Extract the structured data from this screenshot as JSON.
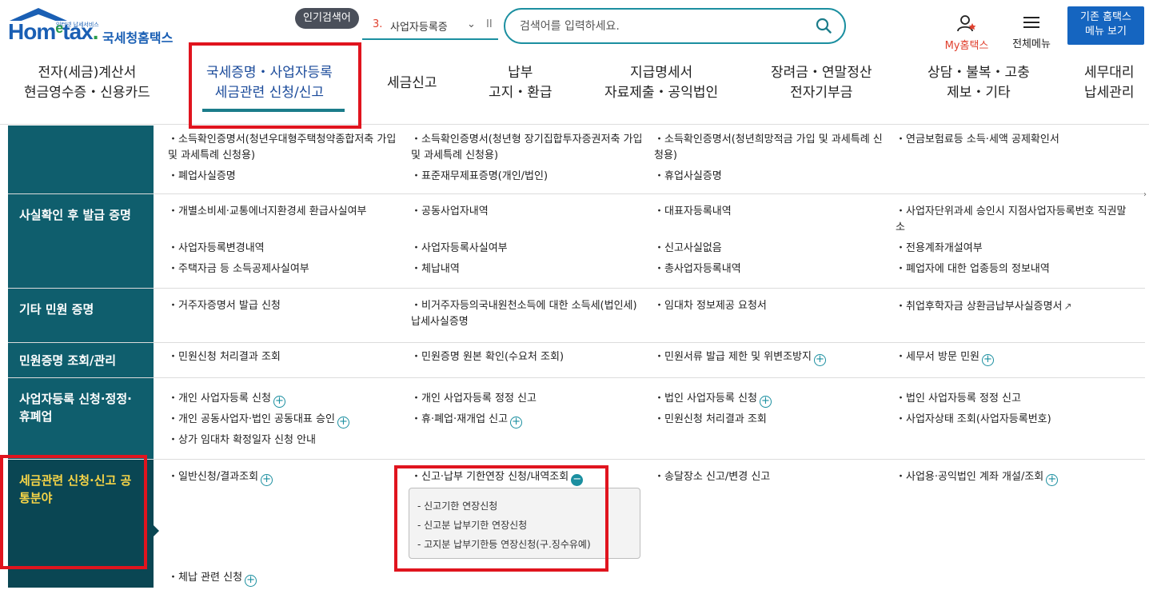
{
  "header": {
    "logo_text": "Hometax.",
    "logo_tagline": "인터넷 납세서비스",
    "logo_kname": "국세청홈택스",
    "popular_label": "인기검색어",
    "popular_rank": "3.",
    "popular_term": "사업자등록증",
    "popular_chevron": "⌄",
    "popular_pause": "II",
    "search_placeholder": "검색어를 입력하세요.",
    "myhome_label": "My홈택스",
    "allmenu_label": "전체메뉴",
    "oldhome_line1": "기존 홈택스",
    "oldhome_line2": "메뉴 보기"
  },
  "gnb": [
    {
      "line1": "전자(세금)계산서",
      "line2": "현금영수증・신용카드"
    },
    {
      "line1": "국세증명・사업자등록",
      "line2": "세금관련 신청/신고"
    },
    {
      "line1": "세금신고",
      "line2": ""
    },
    {
      "line1": "납부",
      "line2": "고지・환급"
    },
    {
      "line1": "지급명세서",
      "line2": "자료제출・공익법인"
    },
    {
      "line1": "장려금・연말정산",
      "line2": "전자기부금"
    },
    {
      "line1": "상담・불복・고충",
      "line2": "제보・기타"
    },
    {
      "line1": "세무대리",
      "line2": "납세관리"
    }
  ],
  "rows": [
    {
      "head": "",
      "cells": [
        "・소득확인증명서(청년우대형주택청약종합저축 가입 및 과세특례 신청용)",
        "・소득확인증명서(청년형 장기집합투자증권저축 가입 및 과세특례 신청용)",
        "・소득확인증명서(청년희망적금 가입 및 과세특례 신청용)",
        "・연금보험료등 소득·세액 공제확인서",
        "・폐업사실증명",
        "・표준재무제표증명(개인/법인)",
        "・휴업사실증명"
      ]
    },
    {
      "head": "사실확인 후 발급 증명",
      "cells": [
        "・개별소비세·교통에너지환경세 환급사실여부",
        "・공동사업자내역",
        "・대표자등록내역",
        "・사업자단위과세 승인시 지점사업자등록번호 직권말소",
        "・사업자등록변경내역",
        "・사업자등록사실여부",
        "・신고사실없음",
        "・전용계좌개설여부",
        "・주택자금 등 소득공제사실여부",
        "・체납내역",
        "・총사업자등록내역",
        "・폐업자에 대한 업종등의 정보내역"
      ]
    },
    {
      "head": "기타 민원 증명",
      "cells": [
        "・거주자증명서 발급 신청",
        "・비거주자등의국내원천소득에 대한 소득세(법인세) 납세사실증명",
        "・임대차 정보제공 요청서",
        "・취업후학자금 상환금납부사실증명서"
      ]
    },
    {
      "head": "민원증명 조회/관리",
      "cells": [
        "・민원신청 처리결과 조회",
        "・민원증명 원본 확인(수요처 조회)",
        "・민원서류 발급 제한 및 위변조방지",
        "・세무서 방문 민원"
      ]
    },
    {
      "head": "사업자등록 신청·정정·휴폐업",
      "cells": [
        "・개인 사업자등록 신청",
        "・개인 사업자등록 정정 신고",
        "・법인 사업자등록 신청",
        "・법인 사업자등록 정정 신고",
        "・개인 공동사업자·법인 공동대표 승인",
        "・휴·폐업·재개업 신고",
        "・민원신청 처리결과 조회",
        "・사업자상태 조회(사업자등록번호)",
        "・상가 임대차 확정일자 신청 안내"
      ]
    },
    {
      "head": "세금관련 신청·신고 공통분야",
      "cells": [
        "・일반신청/결과조회",
        "・신고·납부 기한연장 신청/내역조회",
        "・송달장소 신고/변경 신고",
        "・사업용·공익법인 계좌 개설/조회",
        "・체납 관련 신청"
      ],
      "sublist": [
        "- 신고기한 연장신청",
        "- 신고분 납부기한 연장신청",
        "- 고지분 납부기한등 연장신청(구.징수유예)"
      ]
    }
  ],
  "icons": {
    "plus": "+",
    "minus": "−",
    "external": "↗"
  },
  "colors": {
    "brand_blue": "#1a5fb4",
    "teal": "#1b8fa0",
    "sidebar": "#0f5e6d",
    "highlight_yellow": "#f7d547",
    "annotation_red": "#e0141e"
  }
}
